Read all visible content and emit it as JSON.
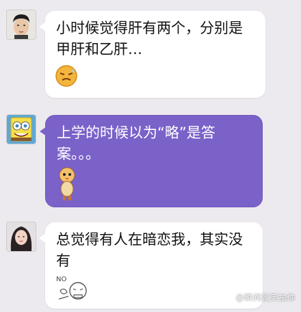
{
  "messages": [
    {
      "text": "小时候觉得肝有两个，分别是甲肝和乙肝…",
      "sticker": "sweat-smiley-sticker"
    },
    {
      "text": "上学的时候以为“略”是答案。。。",
      "sticker": "chick-doll-sticker"
    },
    {
      "text": "总觉得有人在暗恋我，其实没有",
      "sticker": "no-doodle-sticker"
    }
  ],
  "watermark": "@瞬间就笑抽你",
  "colors": {
    "background": "#eceaee",
    "white_bubble": "#ffffff",
    "purple_bubble": "#7b62c9"
  }
}
